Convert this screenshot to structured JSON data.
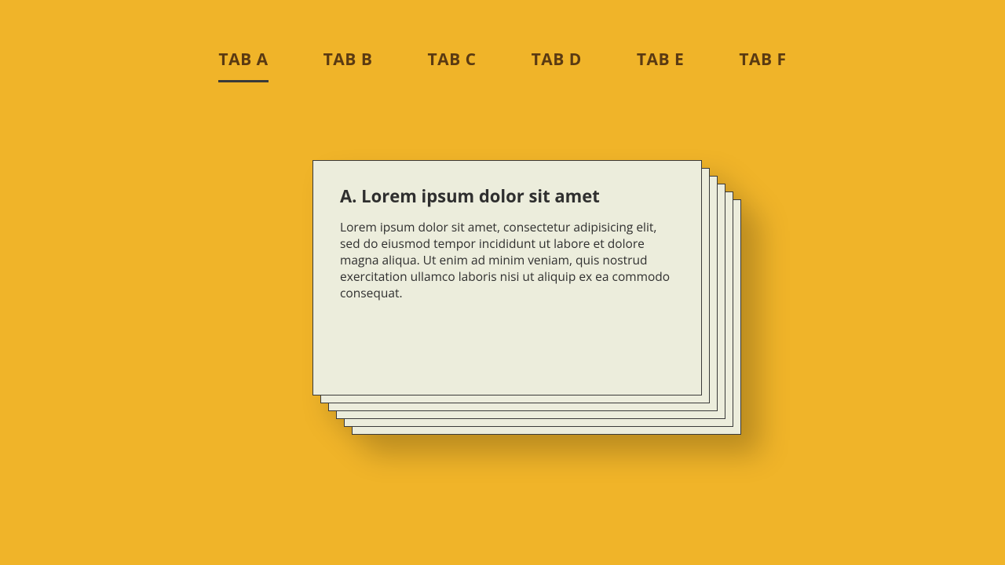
{
  "tabs": [
    {
      "label": "TAB A",
      "active": true
    },
    {
      "label": "TAB B",
      "active": false
    },
    {
      "label": "TAB C",
      "active": false
    },
    {
      "label": "TAB D",
      "active": false
    },
    {
      "label": "TAB E",
      "active": false
    },
    {
      "label": "TAB F",
      "active": false
    }
  ],
  "card": {
    "title": "A. Lorem ipsum dolor sit amet",
    "body": "Lorem ipsum dolor sit amet, consectetur adipisicing elit, sed do eiusmod tempor incididunt ut labore et dolore magna aliqua. Ut enim ad minim veniam, quis nostrud exercitation ullamco laboris nisi ut aliquip ex ea commodo consequat."
  }
}
